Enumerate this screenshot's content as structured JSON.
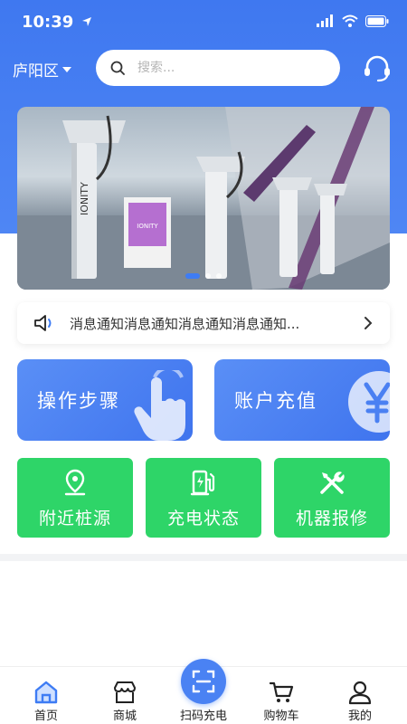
{
  "status_bar": {
    "time": "10:39"
  },
  "header": {
    "location": "庐阳区",
    "search_placeholder": "搜索..."
  },
  "banner": {
    "brand_text": "IONITY",
    "active_dot": 0,
    "dot_count": 3
  },
  "notice": {
    "text": "消息通知消息通知消息通知消息通知..."
  },
  "feature_cards": [
    {
      "label": "操作步骤",
      "icon": "tap-hand-icon"
    },
    {
      "label": "账户充值",
      "icon": "yuan-icon"
    }
  ],
  "quick_actions": [
    {
      "label": "附近桩源",
      "icon": "location-pin-icon"
    },
    {
      "label": "充电状态",
      "icon": "charging-station-icon"
    },
    {
      "label": "机器报修",
      "icon": "repair-tools-icon"
    }
  ],
  "tabbar": {
    "items": [
      {
        "label": "首页",
        "icon": "home-icon",
        "active": true
      },
      {
        "label": "商城",
        "icon": "shop-icon",
        "active": false
      },
      {
        "label": "扫码充电",
        "icon": "scan-icon",
        "active": false
      },
      {
        "label": "购物车",
        "icon": "cart-icon",
        "active": false
      },
      {
        "label": "我的",
        "icon": "user-icon",
        "active": false
      }
    ]
  },
  "colors": {
    "primary_blue": "#3e7cf4",
    "green": "#2ed568",
    "background": "#ffffff"
  }
}
